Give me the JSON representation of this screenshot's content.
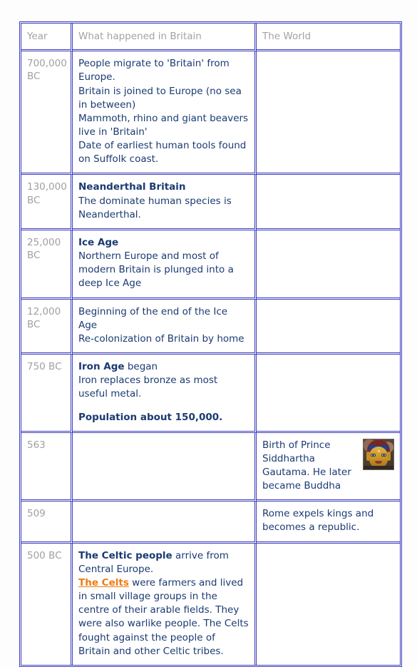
{
  "table": {
    "columns": [
      {
        "key": "year",
        "label": "Year"
      },
      {
        "key": "brit",
        "label": "What happened in Britain"
      },
      {
        "key": "world",
        "label": "The World"
      }
    ],
    "rows": [
      {
        "year": "700,000\nBC",
        "britain": {
          "paragraphs": [
            {
              "runs": [
                {
                  "text": "People migrate to 'Britain' from Europe.",
                  "style": "normal"
                }
              ]
            },
            {
              "runs": [
                {
                  "text": "Britain is joined to Europe (no sea in between)",
                  "style": "normal"
                }
              ]
            },
            {
              "runs": [
                {
                  "text": "Mammoth, rhino and giant beavers live in 'Britain'",
                  "style": "normal"
                }
              ]
            },
            {
              "runs": [
                {
                  "text": "Date of earliest human tools found on Suffolk coast.",
                  "style": "normal"
                }
              ]
            }
          ]
        },
        "world": {
          "paragraphs": [],
          "image": null
        }
      },
      {
        "year": "130,000\nBC",
        "britain": {
          "paragraphs": [
            {
              "runs": [
                {
                  "text": "Neanderthal Britain",
                  "style": "bold"
                }
              ]
            },
            {
              "runs": [
                {
                  "text": "The dominate human species is Neanderthal.",
                  "style": "normal"
                }
              ]
            }
          ]
        },
        "world": {
          "paragraphs": [],
          "image": null
        }
      },
      {
        "year": "25,000\nBC",
        "britain": {
          "paragraphs": [
            {
              "runs": [
                {
                  "text": "Ice Age",
                  "style": "bold"
                }
              ]
            },
            {
              "runs": [
                {
                  "text": "Northern Europe and most of modern Britain is plunged into a deep Ice Age",
                  "style": "normal"
                }
              ]
            }
          ]
        },
        "world": {
          "paragraphs": [],
          "image": null
        }
      },
      {
        "year": "12,000\nBC",
        "britain": {
          "paragraphs": [
            {
              "runs": [
                {
                  "text": "Beginning of the end of the Ice Age",
                  "style": "normal"
                }
              ]
            },
            {
              "runs": [
                {
                  "text": "Re-colonization of Britain by home",
                  "style": "normal"
                }
              ]
            }
          ]
        },
        "world": {
          "paragraphs": [],
          "image": null
        }
      },
      {
        "year": "750 BC",
        "britain": {
          "paragraphs": [
            {
              "runs": [
                {
                  "text": "Iron Age",
                  "style": "bold"
                },
                {
                  "text": " began",
                  "style": "normal"
                }
              ]
            },
            {
              "runs": [
                {
                  "text": "Iron replaces bronze as most useful metal.",
                  "style": "normal"
                }
              ]
            },
            {
              "gap": true,
              "runs": [
                {
                  "text": "Population about 150,000.",
                  "style": "bold"
                }
              ]
            }
          ]
        },
        "world": {
          "paragraphs": [],
          "image": null
        }
      },
      {
        "year": "563",
        "britain": {
          "paragraphs": []
        },
        "world": {
          "paragraphs": [
            {
              "runs": [
                {
                  "text": "Birth of Prince Siddhartha Gautama. He later became Buddha",
                  "style": "normal"
                }
              ]
            }
          ],
          "image": {
            "name": "buddha-head-image",
            "alt": "Golden Buddha head"
          }
        }
      },
      {
        "year": "509",
        "britain": {
          "paragraphs": []
        },
        "world": {
          "paragraphs": [
            {
              "runs": [
                {
                  "text": "Rome expels kings and becomes a republic.",
                  "style": "normal"
                }
              ]
            }
          ],
          "image": null
        }
      },
      {
        "year": "500 BC",
        "britain": {
          "paragraphs": [
            {
              "runs": [
                {
                  "text": "The Celtic people",
                  "style": "bold"
                },
                {
                  "text": " arrive from Central Europe.",
                  "style": "normal"
                }
              ]
            },
            {
              "runs": [
                {
                  "text": "The Celts",
                  "style": "link"
                },
                {
                  "text": " were farmers and lived in small village groups in the centre of their arable fields. They were also warlike people. The Celts fought against the people of Britain and other Celtic tribes.",
                  "style": "normal"
                }
              ]
            }
          ]
        },
        "world": {
          "paragraphs": [],
          "image": null
        }
      }
    ]
  },
  "colors": {
    "border": "#3b3bbf",
    "body_text": "#1b3a72",
    "muted_text": "#a0a0a0",
    "link": "#f07b10",
    "page_background": "#fdfdfd"
  }
}
